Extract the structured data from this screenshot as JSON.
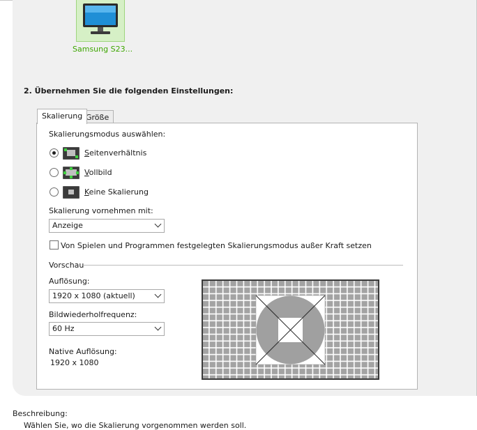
{
  "display": {
    "monitor_label": "Samsung S23..."
  },
  "section": {
    "title": "2. Übernehmen Sie die folgenden Einstellungen:"
  },
  "tabs": [
    {
      "label": "Skalierung",
      "active": true
    },
    {
      "label": "Größe",
      "active": false
    }
  ],
  "scaling": {
    "mode_heading": "Skalierungsmodus auswählen:",
    "modes": [
      {
        "accel": "S",
        "rest": "eitenverhältnis",
        "icon": "aspect-ratio-icon",
        "selected": true
      },
      {
        "accel": "V",
        "rest": "ollbild",
        "icon": "fullscreen-icon",
        "selected": false
      },
      {
        "accel": "K",
        "rest": "eine Skalierung",
        "icon": "no-scaling-icon",
        "selected": false
      }
    ],
    "perform_label": "Skalierung vornehmen mit:",
    "perform_value": "Anzeige",
    "override_label": "Von Spielen und Programmen festgelegten Skalierungsmodus außer Kraft setzen",
    "override_checked": false
  },
  "preview": {
    "heading": "Vorschau",
    "resolution_label": "Auflösung:",
    "resolution_value": "1920 x 1080 (aktuell)",
    "refresh_label": "Bildwiederholfrequenz:",
    "refresh_value": "60 Hz",
    "native_label": "Native Auflösung:",
    "native_value": "1920 x 1080"
  },
  "description": {
    "label": "Beschreibung:",
    "text": "Wählen Sie, wo die Skalierung vorgenommen werden soll."
  },
  "colors": {
    "accent_green": "#3da600",
    "tile_bg": "#d6f0c6",
    "preview_gray": "#a0a0a0"
  }
}
